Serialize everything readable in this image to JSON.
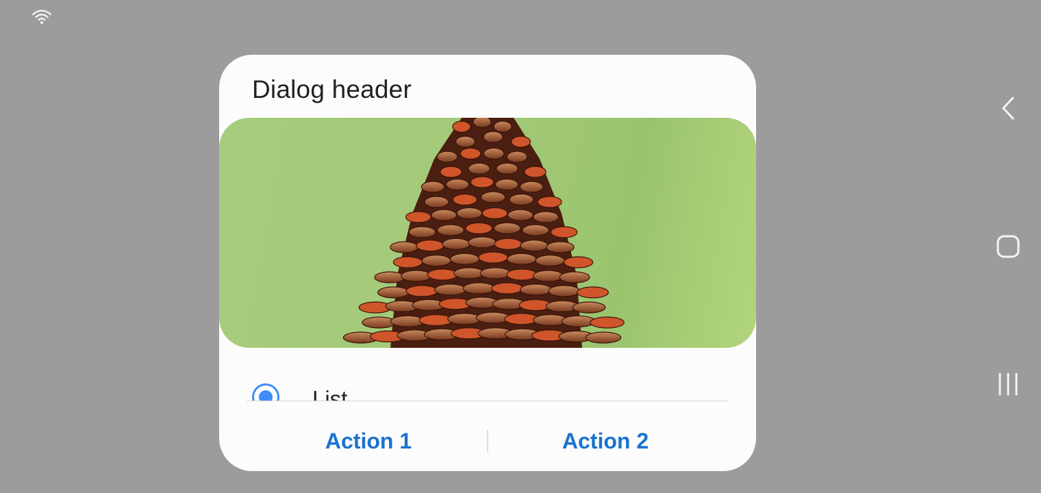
{
  "status_bar": {
    "wifi_icon": "wifi-icon"
  },
  "dialog": {
    "header": "Dialog header",
    "image_icon": "pinecone-photo",
    "list_item": {
      "label": "List",
      "selected": true
    },
    "actions": [
      {
        "label": "Action 1"
      },
      {
        "label": "Action 2"
      }
    ]
  },
  "nav_bar": {
    "back_icon": "back-chevron-icon",
    "home_icon": "home-square-icon",
    "recents_icon": "recents-lines-icon"
  },
  "colors": {
    "scrim": "#9c9c9c",
    "dialog_bg": "#fcfcfc",
    "accent": "#1a73d0",
    "radio": "#3e8ef7",
    "image_bg": "#a5ca7a"
  }
}
